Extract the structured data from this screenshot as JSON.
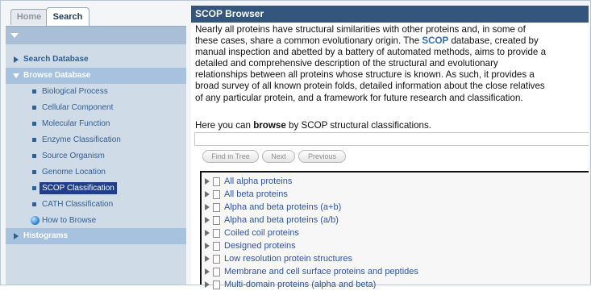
{
  "tabs": {
    "home": "Home",
    "search": "Search"
  },
  "nav": {
    "search_database": "Search Database",
    "browse_database": "Browse Database",
    "sub_items": [
      "Biological Process",
      "Cellular Component",
      "Molecular Function",
      "Enzyme Classification",
      "Source Organism",
      "Genome Location",
      "SCOP Classification",
      "CATH Classification"
    ],
    "selected_sub": "SCOP Classification",
    "how_to_browse": "How to Browse",
    "histograms": "Histograms"
  },
  "main": {
    "title": "SCOP Browser",
    "intro_lines": [
      [
        "Nearly all proteins have structural similarities with other proteins and, in some of"
      ],
      [
        "these cases, share a common evolutionary origin. The ",
        "SCOP",
        " database, created by"
      ],
      [
        "manual inspection and abetted by a battery of automated methods, aims to provide a"
      ],
      [
        "detailed and comprehensive description of the structural and evolutionary"
      ],
      [
        "relationships between all proteins whose structure is known. As such, it provides a"
      ],
      [
        "broad survey of all known protein folds, detailed information about the close relatives"
      ],
      [
        "of any particular protein, and a framework for future research and classification."
      ]
    ],
    "browse_prefix": "Here you can ",
    "browse_bold": "browse",
    "browse_suffix": " by SCOP structural classifications.",
    "search_value": "",
    "buttons": {
      "find": "Find in Tree",
      "next": "Next",
      "previous": "Previous"
    },
    "tree_items": [
      "All alpha proteins",
      "All beta proteins",
      "Alpha and beta proteins (a+b)",
      "Alpha and beta proteins (a/b)",
      "Coiled coil proteins",
      "Designed proteins",
      "Low resolution protein structures",
      "Membrane and cell surface proteins and peptides",
      "Multi-domain proteins (alpha and beta)"
    ]
  },
  "colors": {
    "header_bg": "#33567c",
    "nav_text": "#2f5f94",
    "selected_bg": "#1f3f8c",
    "link": "#2d55a6"
  }
}
